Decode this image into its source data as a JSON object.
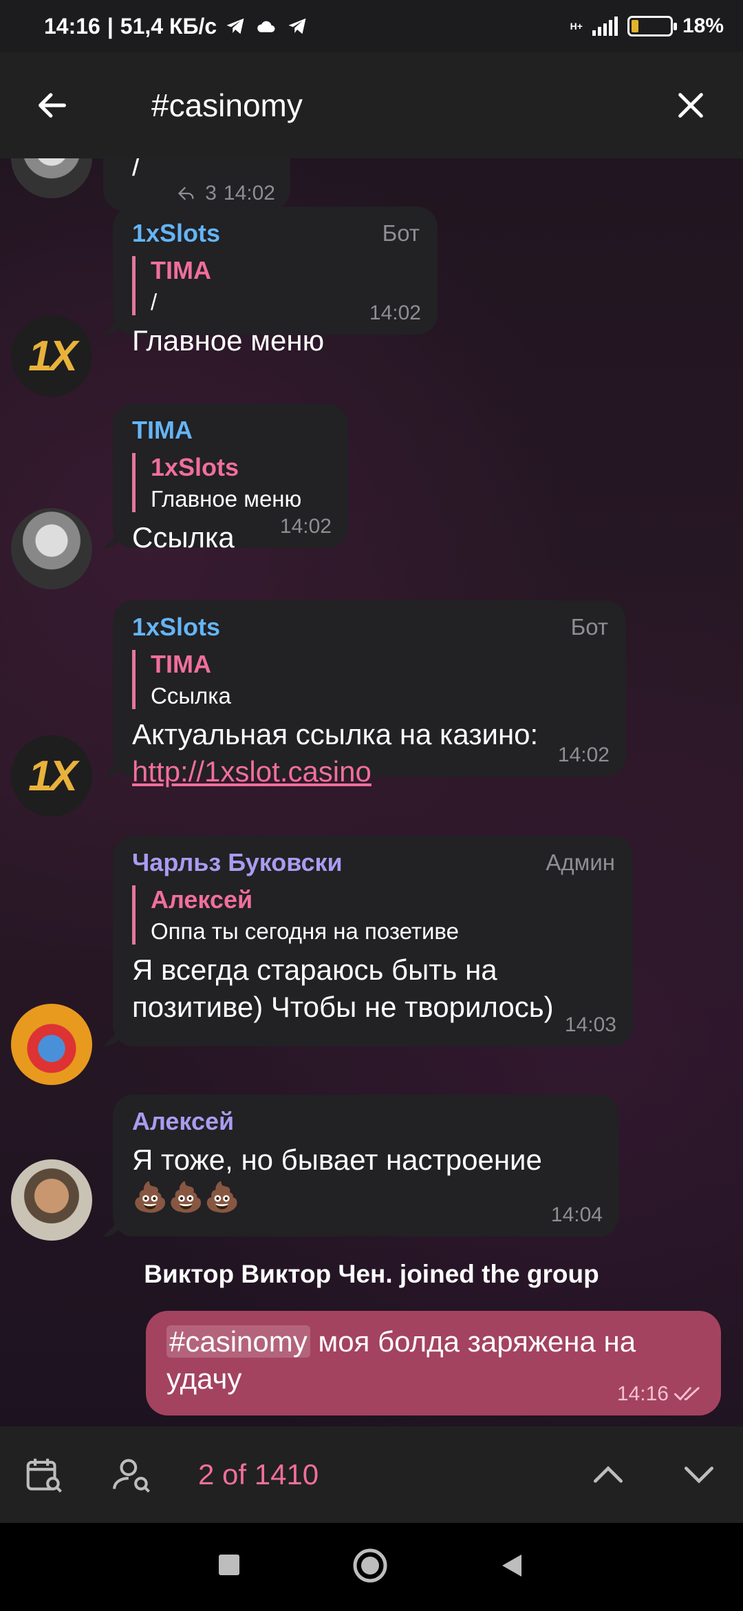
{
  "status": {
    "time": "14:16",
    "speed": "51,4 КБ/с",
    "network": "H+",
    "battery": "18%",
    "battery_level": 0.18
  },
  "header": {
    "back_icon": "arrow-left-icon",
    "search_query": "#casinomy",
    "close_icon": "close-icon"
  },
  "messages": [
    {
      "partial_text": "/",
      "replies": "3",
      "time": "14:02"
    },
    {
      "sender": "1xSlots",
      "role": "Бот",
      "reply_name": "TIMA",
      "reply_text": "/",
      "text": "Главное меню",
      "time": "14:02"
    },
    {
      "sender": "TIMA",
      "reply_name": "1xSlots",
      "reply_text": "Главное меню",
      "text": "Ссылка",
      "time": "14:02"
    },
    {
      "sender": "1xSlots",
      "role": "Бот",
      "reply_name": "TIMA",
      "reply_text": "Ссылка",
      "text": "Актуальная ссылка на казино:",
      "link": "http://1xslot.casino",
      "time": "14:02"
    },
    {
      "sender": "Чарльз Буковски",
      "role": "Админ",
      "reply_name": "Алексей",
      "reply_text": "Оппа ты сегодня на позетиве",
      "text": "Я всегда стараюсь быть на позитиве) Чтобы не творилось)",
      "time": "14:03"
    },
    {
      "sender": "Алексей",
      "text": "Я тоже, но бывает настроение",
      "emoji": "💩💩💩",
      "time": "14:04"
    }
  ],
  "service_message": "Виктор Виктор Чен. joined the group",
  "outgoing": {
    "hashtag": "#casinomy",
    "text": " моя болда заряжена на удачу",
    "time": "14:16"
  },
  "bottom": {
    "calendar_icon": "calendar-search-icon",
    "user_icon": "user-search-icon",
    "counter": "2 of 1410",
    "up_icon": "chevron-up-icon",
    "down_icon": "chevron-down-icon"
  },
  "colors": {
    "accent": "#f06f9b",
    "sender_blue": "#64b5f6",
    "sender_purple": "#a99cf0",
    "outgoing_bubble": "#a3435f"
  }
}
